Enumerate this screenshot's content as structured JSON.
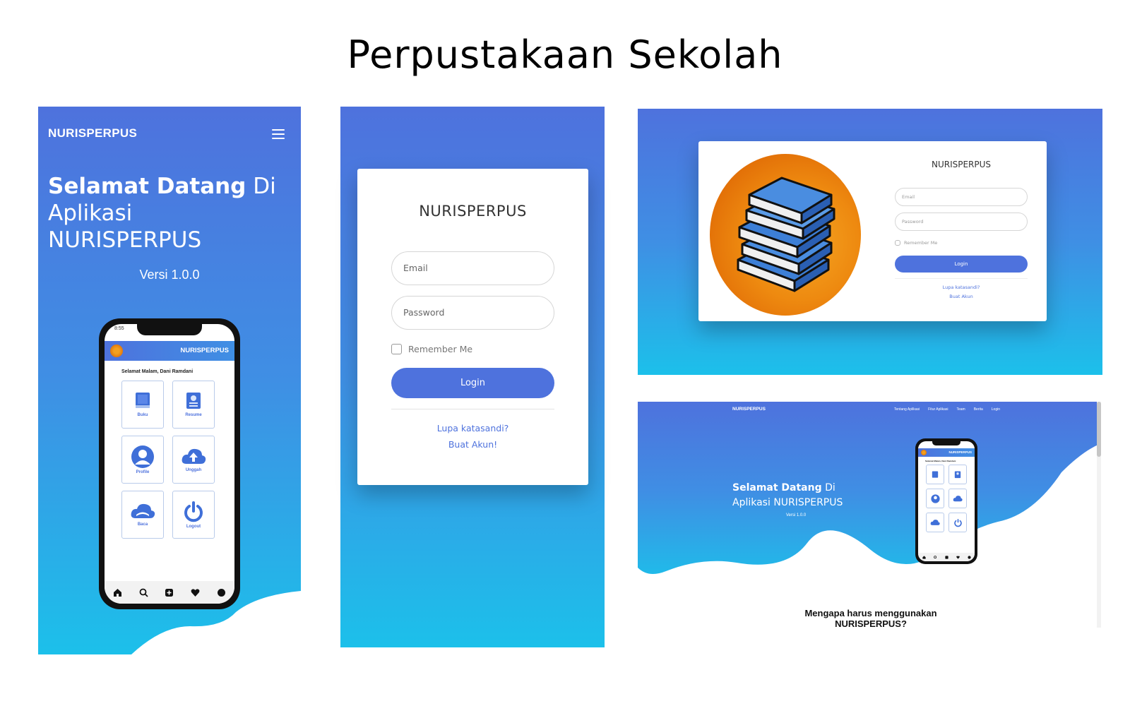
{
  "page": {
    "title": "Perpustakaan Sekolah"
  },
  "mobile_landing": {
    "brand": "NURISPERPUS",
    "menu_icon": "hamburger-icon",
    "welcome_bold": "Selamat Datang",
    "welcome_rest_1": " Di",
    "welcome_line_2": "Aplikasi",
    "welcome_line_3": "NURISPERPUS",
    "version": "Versi 1.0.0"
  },
  "phone_app": {
    "status_time": "8:55",
    "header": "NURISPERPUS",
    "greeting": "Selamat Malam, Dani Ramdani",
    "tiles": [
      {
        "label": "Buku",
        "icon": "book-icon"
      },
      {
        "label": "Resume",
        "icon": "document-icon"
      },
      {
        "label": "Profile",
        "icon": "user-icon"
      },
      {
        "label": "Unggah",
        "icon": "cloud-upload-icon"
      },
      {
        "label": "Baca",
        "icon": "cloud-read-icon"
      },
      {
        "label": "Logout",
        "icon": "power-icon"
      }
    ],
    "nav_icons": [
      "home-icon",
      "search-icon",
      "add-icon",
      "heart-icon",
      "profile-dot-icon"
    ]
  },
  "mobile_login": {
    "title": "NURISPERPUS",
    "email_placeholder": "Email",
    "password_placeholder": "Password",
    "remember_label": "Remember Me",
    "login_label": "Login",
    "forgot_link": "Lupa katasandi?",
    "register_link": "Buat Akun!"
  },
  "desktop_login": {
    "title": "NURISPERPUS",
    "logo_icon": "books-stack-icon",
    "email_placeholder": "Email",
    "password_placeholder": "Password",
    "remember_label": "Remember Me",
    "login_label": "Login",
    "forgot_link": "Lupa katasandi?",
    "register_link": "Buat Akun"
  },
  "desktop_landing": {
    "brand": "NURISPERPUS",
    "nav": [
      "Tentang Aplikasi",
      "Fitur Aplikasi",
      "Team",
      "Berita",
      "Login"
    ],
    "welcome_bold": "Selamat Datang",
    "welcome_rest": " Di",
    "welcome_line_2": "Aplikasi NURISPERPUS",
    "version": "Versi 1.0.0",
    "section_heading_1": "Mengapa harus menggunakan",
    "section_heading_2": "NURISPERPUS?"
  },
  "colors": {
    "primary": "#4e72dd",
    "gradient_bottom": "#1cc0ea",
    "logo_orange": "#ee8a10"
  }
}
